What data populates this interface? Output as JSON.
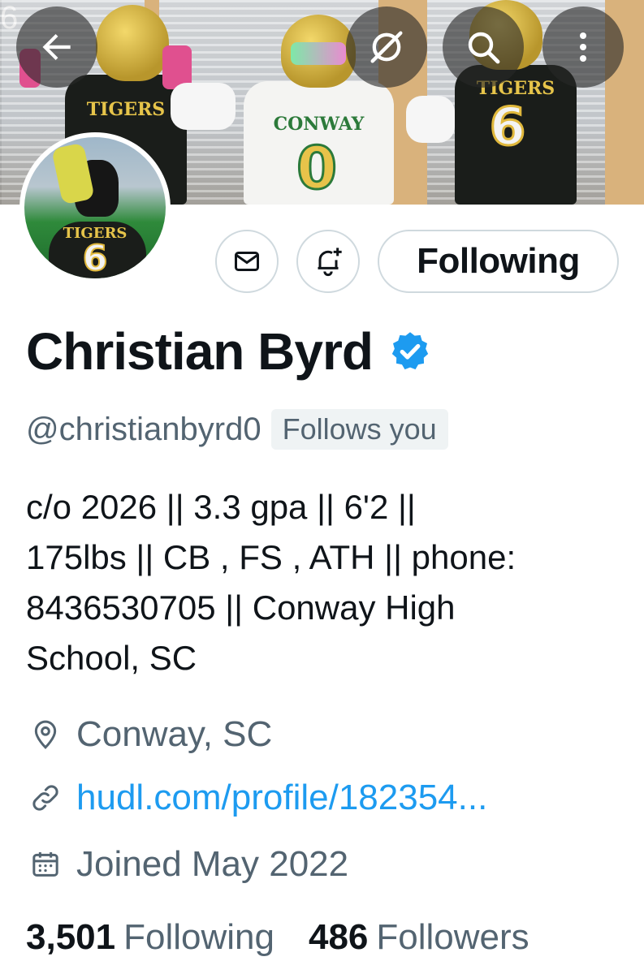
{
  "header": {
    "back_icon": "arrow-left-icon",
    "grok_icon": "grok-icon",
    "search_icon": "search-icon",
    "more_icon": "more-vertical-icon",
    "banner_jersey_texts": [
      "TIGERS",
      "6",
      "CONWAY",
      "0",
      "TIGERS",
      "6"
    ]
  },
  "avatar": {
    "jersey_text": "TIGERS",
    "jersey_number": "6"
  },
  "actions": {
    "message_icon": "envelope-icon",
    "notify_icon": "bell-plus-icon",
    "following_label": "Following"
  },
  "profile": {
    "name": "Christian Byrd",
    "verified": true,
    "handle": "@christianbyrd0",
    "follows_you": "Follows you",
    "bio_lines": [
      "c/o 2026 || 3.3 gpa || 6'2 ||",
      "175lbs || CB , FS , ATH || phone:",
      "8436530705 || Conway High",
      "School, SC"
    ],
    "location": "Conway, SC",
    "website": "hudl.com/profile/182354...",
    "joined": "Joined May 2022",
    "following_count": "3,501",
    "following_label": "Following",
    "followers_count": "486",
    "followers_label": "Followers"
  },
  "colors": {
    "accent": "#1d9bf0",
    "text": "#0f1419",
    "muted": "#536471",
    "border": "#cfd9de"
  }
}
